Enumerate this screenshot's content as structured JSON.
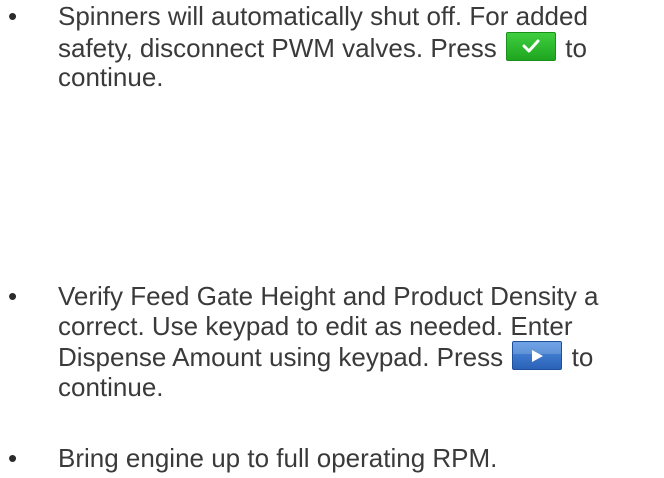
{
  "colors": {
    "check_button": "#2bb52b",
    "play_button": "#3a78cc",
    "text": "#3a3a3a"
  },
  "icons": {
    "check": "check-icon",
    "play": "play-icon"
  },
  "bullets": [
    {
      "line1": "Spinners will automatically shut off.  For added",
      "line2_before": "safety, disconnect PWM valves.  Press",
      "line2_after": "to",
      "line3": "continue."
    },
    {
      "line1": "Verify Feed Gate Height and Product Density a",
      "line2": "correct.  Use keypad to edit as needed.  Enter",
      "line3_before": "Dispense Amount using keypad.  Press",
      "line3_after": "to",
      "line4": "continue."
    },
    {
      "line1": "Bring engine up to full operating RPM."
    }
  ]
}
